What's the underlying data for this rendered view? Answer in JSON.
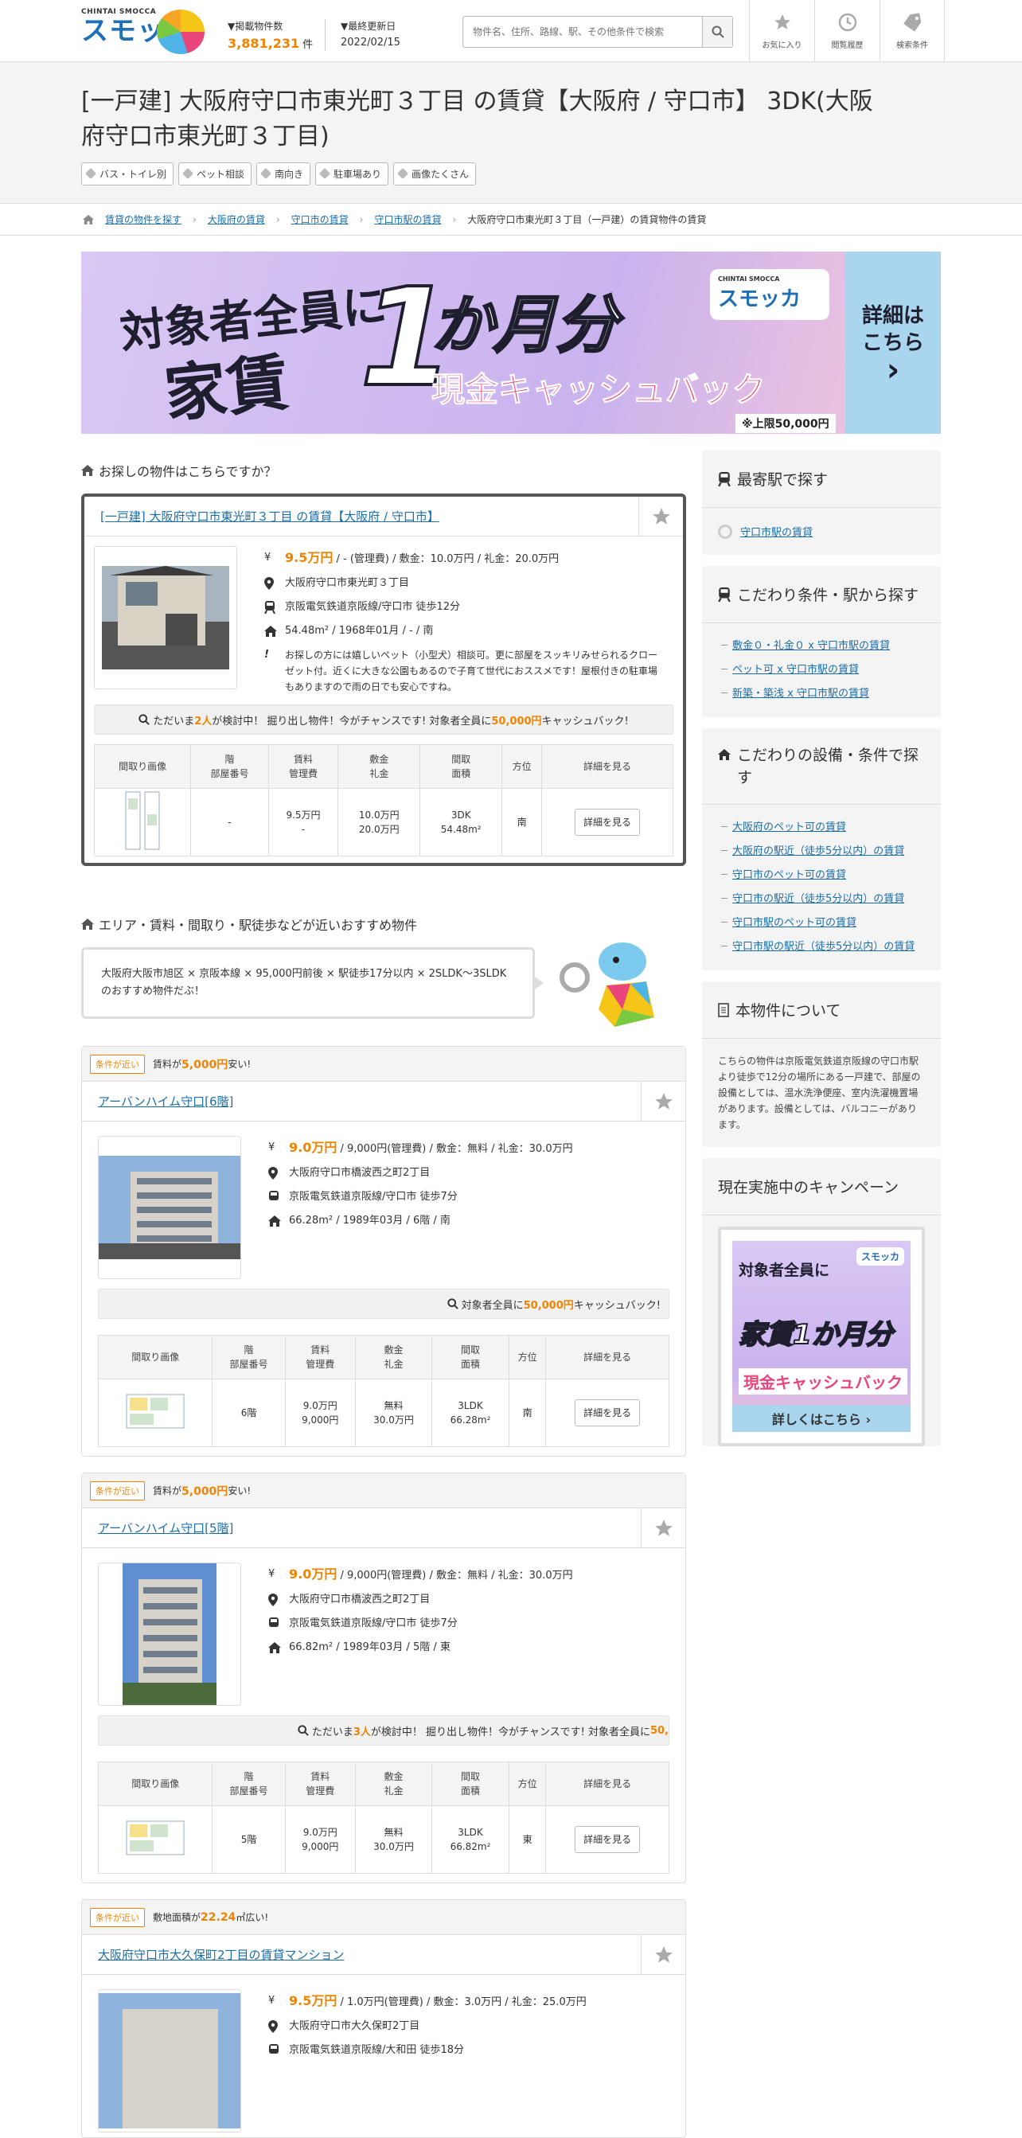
{
  "header": {
    "logo_small": "CHINTAI SMOCCA",
    "logo_big": "スモッカ",
    "count_label": "▼掲載物件数",
    "count_value": "3,881,231",
    "count_unit": "件",
    "updated_label": "▼最終更新日",
    "updated_value": "2022/02/15",
    "search_placeholder": "物件名、住所、路線、駅、その他条件で検索",
    "nav": [
      {
        "label": "お気に入り",
        "icon": "star-icon"
      },
      {
        "label": "閲覧履歴",
        "icon": "clock-icon"
      },
      {
        "label": "検索条件",
        "icon": "tag-icon"
      }
    ]
  },
  "title": {
    "line1": "[一戸建] 大阪府守口市東光町３丁目 の賃貸【大阪府 / 守口市】 3DK(大阪",
    "line2": "府守口市東光町３丁目)",
    "tags": [
      "バス・トイレ別",
      "ペット相談",
      "南向き",
      "駐車場あり",
      "画像たくさん"
    ]
  },
  "breadcrumb": [
    "賃貸の物件を探す",
    "大阪府の賃貸",
    "守口市の賃貸",
    "守口市駅の賃貸",
    "大阪府守口市東光町３丁目（一戸建）の賃貸物件の賃貸"
  ],
  "banner": {
    "t1": "対象者全員に",
    "t2": "家賃",
    "n1": "1",
    "t3": "か月分",
    "t4": "現金キャッシュバック",
    "logo_small": "CHINTAI SMOCCA",
    "logo_big": "スモッカ",
    "limit": "※上限50,000円",
    "right1": "詳細は",
    "right2": "こちら",
    "right3": "›"
  },
  "featured": {
    "section_title": "お探しの物件はこちらですか？",
    "title": "[一戸建] 大阪府守口市東光町３丁目 の賃貸【大阪府 / 守口市】",
    "price": "9.5万円",
    "price_rest": " / - (管理費) / 敷金：10.0万円 / 礼金：20.0万円",
    "address": "大阪府守口市東光町３丁目",
    "station": "京阪電気鉄道京阪線/守口市 徒歩12分",
    "spec": "54.48m² / 1968年01月 / - / 南",
    "note": "お探しの方には嬉しいペット（小型犬）相談可。更に部屋をスッキリみせられるクローゼット付。近くに大きな公園もあるので子育て世代におススメです！屋根付きの駐車場もありますので雨の日でも安心ですね。",
    "cta_pre": "ただいま",
    "cta_num": "2人",
    "cta_mid": "が検討中！ 掘り出し物件！今がチャンスです! 対象者全員に",
    "cta_amt": "50,000円",
    "cta_post": "キャッシュバック!",
    "row": {
      "floor": "-",
      "rent": "9.5万円",
      "mgmt": "-",
      "deposit": "10.0万円",
      "key": "20.0万円",
      "layout": "3DK",
      "area": "54.48m²",
      "dir": "南",
      "btn": "詳細を見る"
    }
  },
  "table_headers": {
    "h1": "間取り画像",
    "h2a": "階",
    "h2b": "部屋番号",
    "h3a": "賃料",
    "h3b": "管理費",
    "h4a": "敷金",
    "h4b": "礼金",
    "h5a": "間取",
    "h5b": "面積",
    "h6": "方位",
    "h7": "詳細を見る"
  },
  "recommend": {
    "section_title": "エリア・賃料・間取り・駅徒歩などが近いおすすめ物件",
    "bubble": "大阪府大阪市旭区 × 京阪本線 × 95,000円前後 × 駅徒歩17分以内 × 2SLDK〜3SLDKのおすすめ物件だぶ！"
  },
  "cards": [
    {
      "badge": "条件が近い",
      "cond_pre": "賃料が",
      "cond_num": "5,000円",
      "cond_post": "安い!",
      "title": "アーバンハイム守口[6階]",
      "price": "9.0万円",
      "price_rest": " / 9,000円(管理費) / 敷金：無料 / 礼金：30.0万円",
      "address": "大阪府守口市橋波西之町2丁目",
      "station": "京阪電気鉄道京阪線/守口市 徒歩7分",
      "spec": "66.28m² / 1989年03月 / 6階 / 南",
      "cta_pre": "対象者全員に",
      "cta_num": "50,000円",
      "cta_post": "キャッシュバック!",
      "row": {
        "floor": "6階",
        "rent": "9.0万円",
        "mgmt": "9,000円",
        "deposit": "無料",
        "key": "30.0万円",
        "layout": "3LDK",
        "area": "66.28m²",
        "dir": "南",
        "btn": "詳細を見る"
      }
    },
    {
      "badge": "条件が近い",
      "cond_pre": "賃料が",
      "cond_num": "5,000円",
      "cond_post": "安い!",
      "title": "アーバンハイム守口[5階]",
      "price": "9.0万円",
      "price_rest": " / 9,000円(管理費) / 敷金：無料 / 礼金：30.0万円",
      "address": "大阪府守口市橋波西之町2丁目",
      "station": "京阪電気鉄道京阪線/守口市 徒歩7分",
      "spec": "66.82m² / 1989年03月 / 5階 / 東",
      "cta_pre": "ただいま",
      "cta_num": "3人",
      "cta_mid": "が検討中！ 掘り出し物件！今がチャンスです! 対象者全員に",
      "cta_amt": "50,",
      "row": {
        "floor": "5階",
        "rent": "9.0万円",
        "mgmt": "9,000円",
        "deposit": "無料",
        "key": "30.0万円",
        "layout": "3LDK",
        "area": "66.82m²",
        "dir": "東",
        "btn": "詳細を見る"
      }
    },
    {
      "badge": "条件が近い",
      "cond_pre": "敷地面積が",
      "cond_num": "22.24",
      "cond_post": "㎡広い!",
      "title": "大阪府守口市大久保町2丁目の賃貸マンション",
      "price": "9.5万円",
      "price_rest": " / 1.0万円(管理費) / 敷金：3.0万円 / 礼金：25.0万円",
      "address": "大阪府守口市大久保町2丁目",
      "station": "京阪電気鉄道京阪線/大和田 徒歩18分"
    }
  ],
  "sidebar": {
    "nearest_title": "最寄駅で探す",
    "nearest_item": "守口市駅の賃貸",
    "cond_title": "こだわり条件・駅から探す",
    "cond_items": [
      "敷金０・礼金０ x 守口市駅の賃貸",
      "ペット可 x 守口市駅の賃貸",
      "新築・築浅 x 守口市駅の賃貸"
    ],
    "equip_title": "こだわりの設備・条件で探す",
    "equip_items": [
      "大阪府のペット可の賃貸",
      "大阪府の駅近（徒歩5分以内）の賃貸",
      "守口市のペット可の賃貸",
      "守口市の駅近（徒歩5分以内）の賃貸",
      "守口市駅のペット可の賃貸",
      "守口市駅の駅近（徒歩5分以内）の賃貸"
    ],
    "about_title": "本物件について",
    "about_text": "こちらの物件は京阪電気鉄道京阪線の守口市駅より徒歩で12分の場所にある一戸建で、部屋の設備としては、温水洗浄便座、室内洗濯機置場があります。設備としては、バルコニーがあります。",
    "camp_title": "現在実施中のキャンペーン",
    "camp_a": "対象者全員に",
    "camp_b": "家賃1か月分",
    "camp_c": "現金キャッシュバック",
    "camp_d": "詳しくはこちら ›",
    "camp_logo": "スモッカ"
  }
}
